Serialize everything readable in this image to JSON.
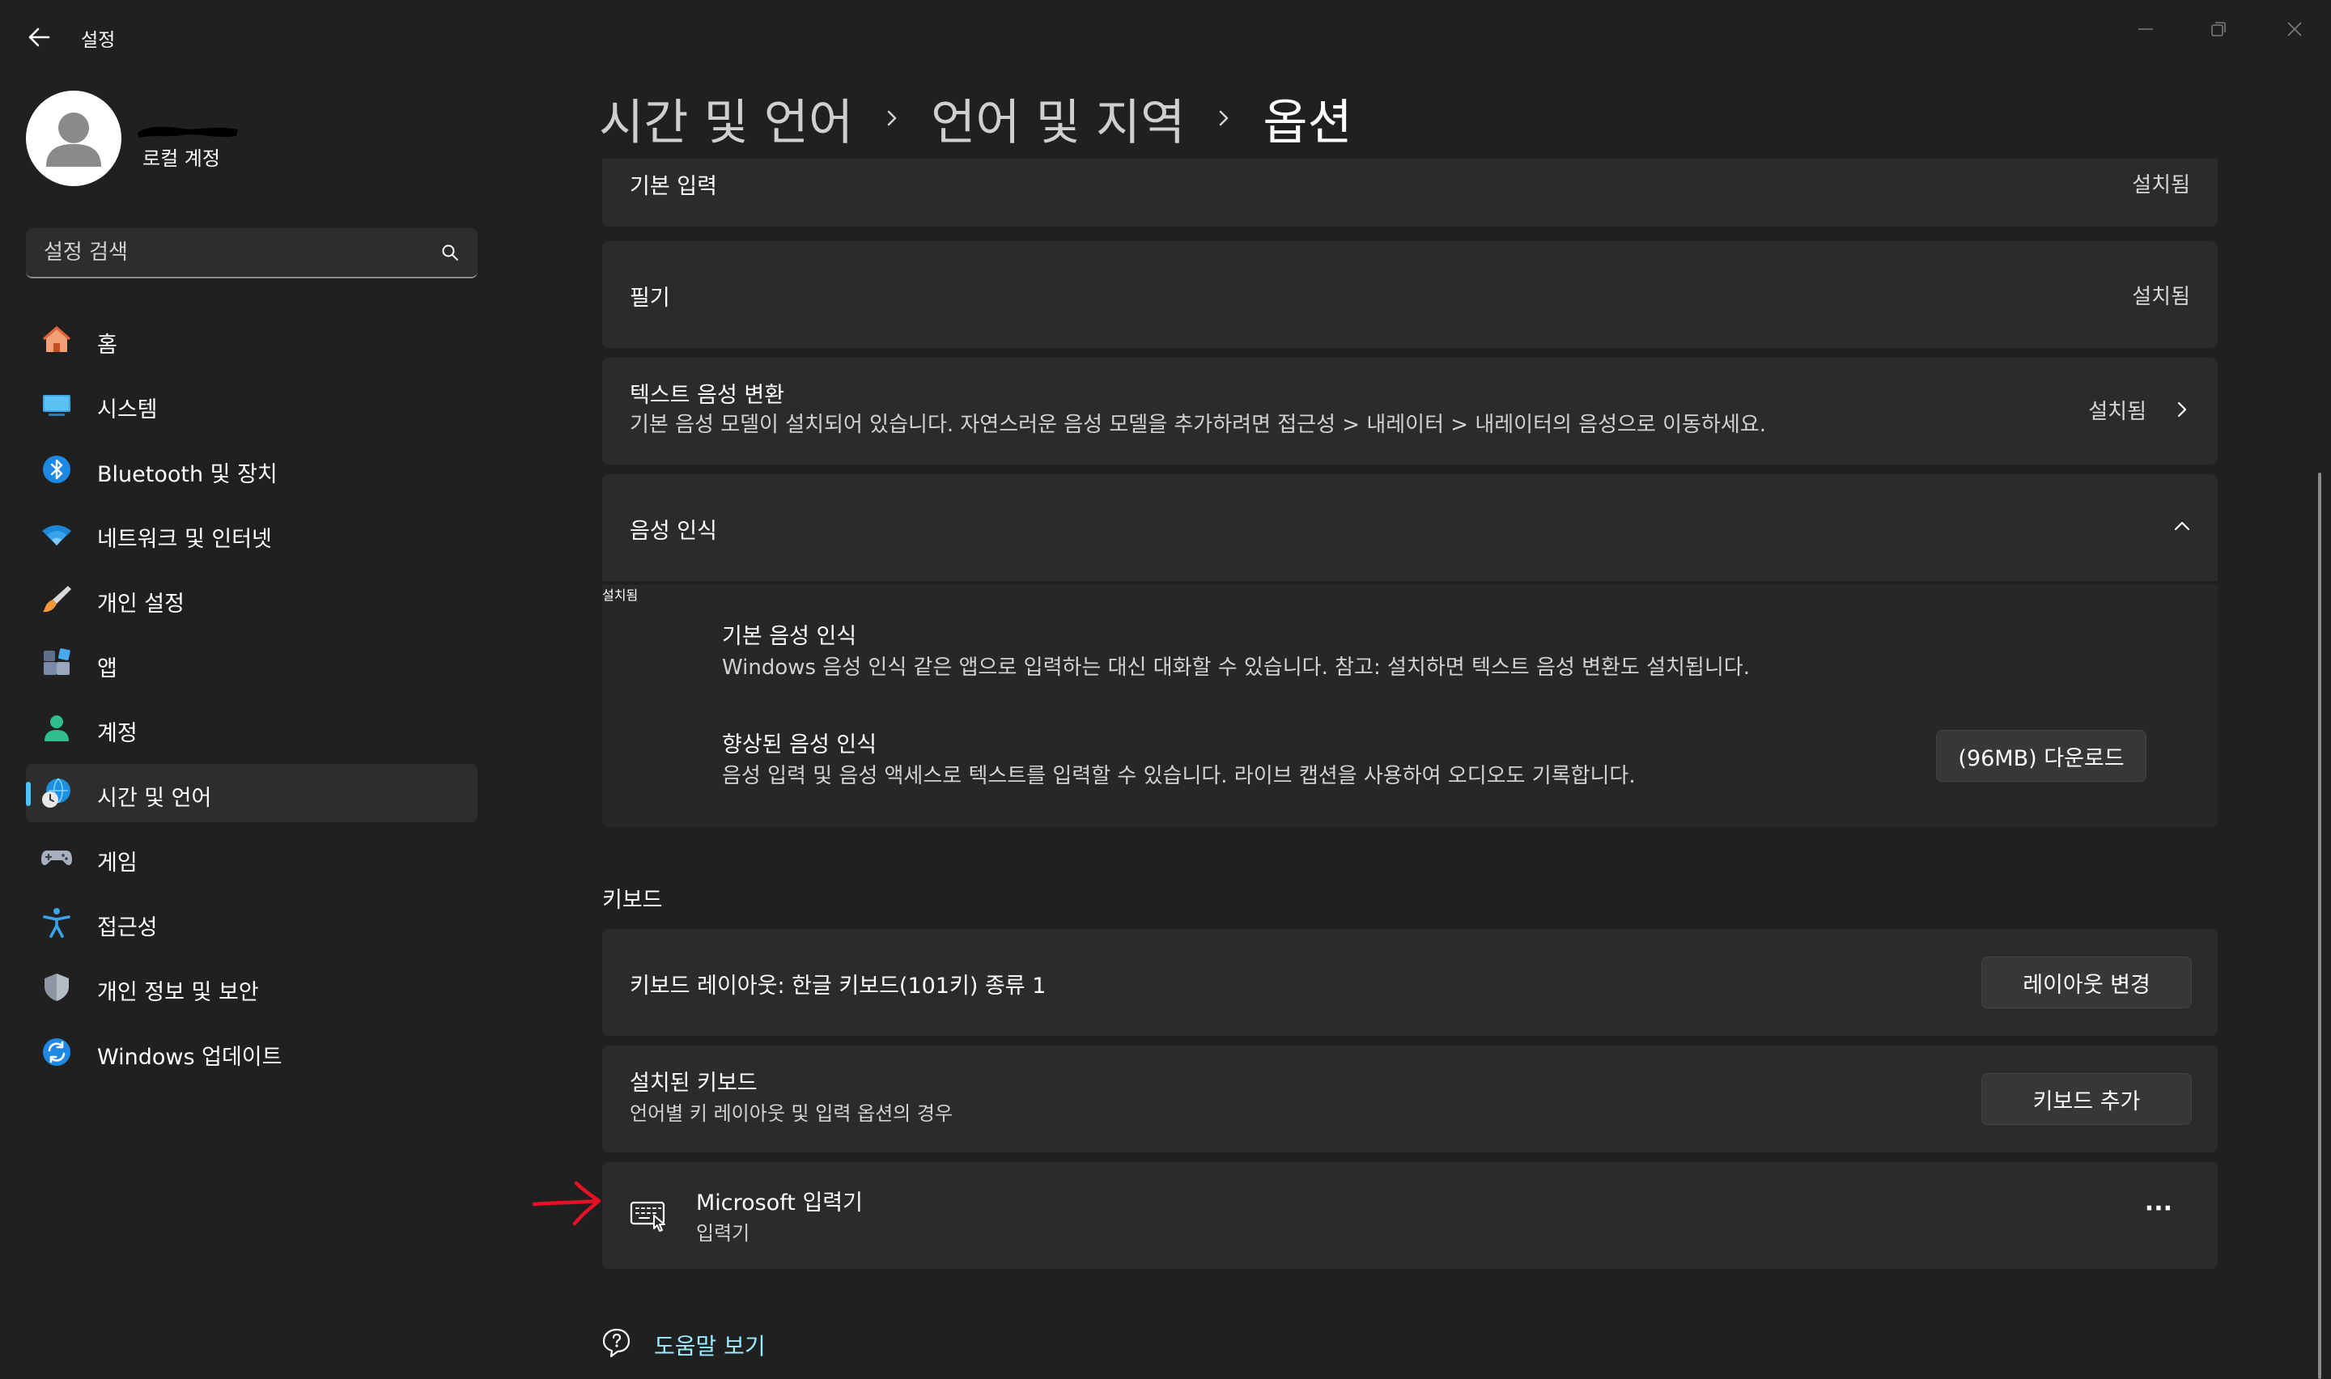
{
  "window": {
    "title": "설정"
  },
  "profile": {
    "subtitle": "로컬 계정"
  },
  "search": {
    "placeholder": "설정 검색"
  },
  "nav": [
    {
      "label": "홈",
      "icon": "home-icon"
    },
    {
      "label": "시스템",
      "icon": "system-icon"
    },
    {
      "label": "Bluetooth 및 장치",
      "icon": "bluetooth-icon"
    },
    {
      "label": "네트워크 및 인터넷",
      "icon": "wifi-icon"
    },
    {
      "label": "개인 설정",
      "icon": "brush-icon"
    },
    {
      "label": "앱",
      "icon": "apps-icon"
    },
    {
      "label": "계정",
      "icon": "account-icon"
    },
    {
      "label": "시간 및 언어",
      "icon": "time-language-icon",
      "selected": true
    },
    {
      "label": "게임",
      "icon": "gamepad-icon"
    },
    {
      "label": "접근성",
      "icon": "accessibility-icon"
    },
    {
      "label": "개인 정보 및 보안",
      "icon": "shield-icon"
    },
    {
      "label": "Windows 업데이트",
      "icon": "update-icon"
    }
  ],
  "breadcrumb": [
    "시간 및 언어",
    "언어 및 지역",
    "옵션"
  ],
  "features": {
    "basic_typing": {
      "title": "기본 입력",
      "status": "설치됨"
    },
    "handwriting": {
      "title": "필기",
      "status": "설치됨"
    },
    "tts": {
      "title": "텍스트 음성 변환",
      "desc": "기본 음성 모델이 설치되어 있습니다. 자연스러운 음성 모델을 추가하려면 접근성 > 내레이터 > 내레이터의 음성으로 이동하세요.",
      "status": "설치됨"
    },
    "speech": {
      "title": "음성 인식",
      "basic": {
        "title": "기본 음성 인식",
        "desc": "Windows 음성 인식 같은 앱으로 입력하는 대신 대화할 수 있습니다. 참고: 설치하면 텍스트 음성 변환도 설치됩니다.",
        "status": "설치됨"
      },
      "enhanced": {
        "title": "향상된 음성 인식",
        "desc": "음성 입력 및 음성 액세스로 텍스트를 입력할 수 있습니다. 라이브 캡션을 사용하여 오디오도 기록합니다.",
        "button": "(96MB) 다운로드"
      }
    }
  },
  "keyboard": {
    "section_title": "키보드",
    "layout": {
      "title": "키보드 레이아웃: 한글 키보드(101키) 종류 1",
      "button": "레이아웃 변경"
    },
    "installed": {
      "title": "설치된 키보드",
      "desc": "언어별 키 레이아웃 및 입력 옵션의 경우",
      "button": "키보드 추가"
    },
    "ime": {
      "title": "Microsoft 입력기",
      "desc": "입력기",
      "more": "···"
    }
  },
  "help": {
    "label": "도움말 보기"
  },
  "colors": {
    "background": "#202020",
    "card": "#2b2b2b",
    "accent": "#4cc2ff",
    "link": "#99ebff",
    "annotation": "#e81123"
  }
}
